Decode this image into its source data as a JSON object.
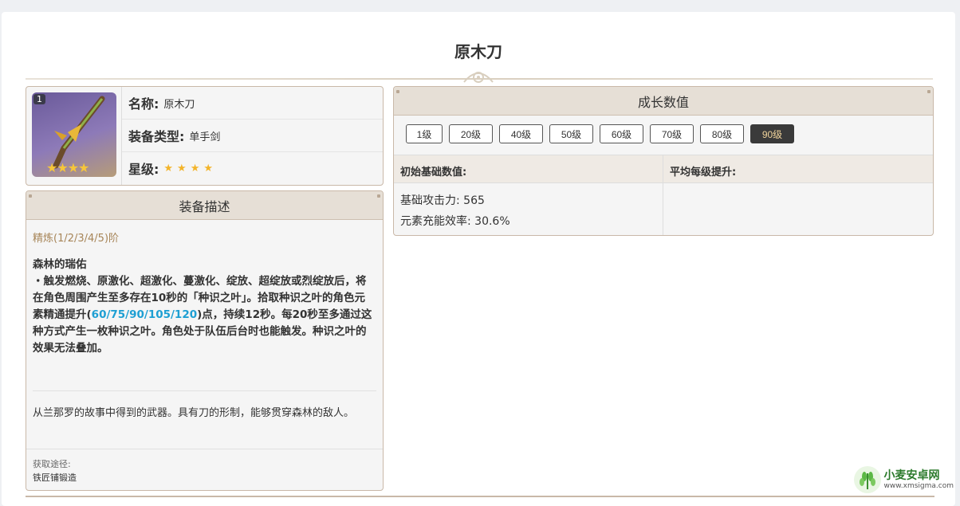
{
  "page": {
    "title": "原木刀"
  },
  "info": {
    "level_badge": "1",
    "stars_overlay": "★★★★",
    "name_label": "名称:",
    "name_value": "原木刀",
    "type_label": "装备类型:",
    "type_value": "单手剑",
    "rarity_label": "星级:",
    "rarity_value": "★★★★"
  },
  "description": {
    "header": "装备描述",
    "refine": "精炼(1/2/3/4/5)阶",
    "skill_name": "森林的瑞佑",
    "skill_text_1": "・触发燃烧、原激化、超激化、蔓激化、绽放、超绽放或烈绽放后，将在角色周围产生至多存在10秒的「种识之叶」。拾取种识之叶的角色元素精通提升(",
    "skill_highlight": "60/75/90/105/120",
    "skill_text_2": ")点，持续12秒。每20秒至多通过这种方式产生一枚种识之叶。角色处于队伍后台时也能触发。种识之叶的效果无法叠加。",
    "lore": "从兰那罗的故事中得到的武器。具有刀的形制，能够贯穿森林的敌人。",
    "source_label": "获取途径:",
    "source_value": "铁匠铺锻造"
  },
  "growth": {
    "header": "成长数值",
    "levels": [
      "1级",
      "20级",
      "40级",
      "50级",
      "60级",
      "70级",
      "80级",
      "90级"
    ],
    "active_level": "90级",
    "base_header": "初始基础数值:",
    "avg_header": "平均每级提升:",
    "stat_1": "基础攻击力: 565",
    "stat_2": "元素充能效率: 30.6%"
  },
  "watermark": {
    "title": "小麦安卓网",
    "url": "www.xmsigma.com"
  },
  "colors": {
    "accent_blue": "#1e9fd3",
    "refine_gold": "#a78558",
    "active_bg": "#3a3a3a",
    "star": "#f3b42a"
  }
}
